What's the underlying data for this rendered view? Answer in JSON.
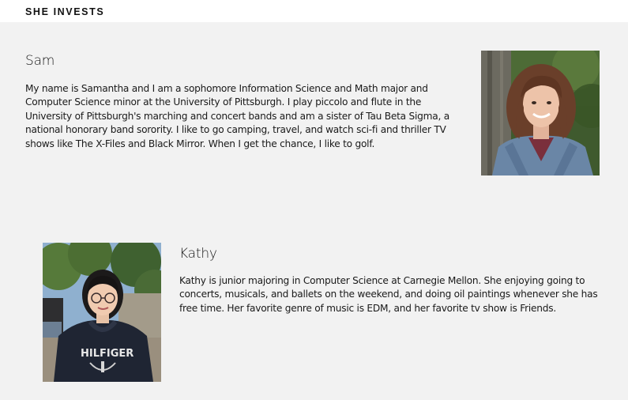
{
  "header": {
    "brand": "SHE INVESTS"
  },
  "profiles": [
    {
      "name": "Sam",
      "bio": "My name is Samantha and I am a sophomore Information Science and Math major and Computer Science minor at the University of Pittsburgh. I play piccolo and flute in the University of Pittsburgh's marching and concert bands and am a sister of Tau Beta Sigma, a national honorary band sorority. I like to go camping, travel, and watch sci-fi and thriller TV shows like The X-Files and Black Mirror. When I get the chance, I like to golf."
    },
    {
      "name": "Kathy",
      "bio": "Kathy is junior majoring in Computer Science at Carnegie Mellon. She enjoying going to concerts, musicals, and ballets on the weekend, and doing oil paintings whenever she has free time. Her favorite genre of music is EDM, and her favorite tv show is Friends."
    }
  ],
  "colors": {
    "page_background": "#f2f2f2",
    "header_background": "#ffffff",
    "text": "#1a1a1a"
  }
}
